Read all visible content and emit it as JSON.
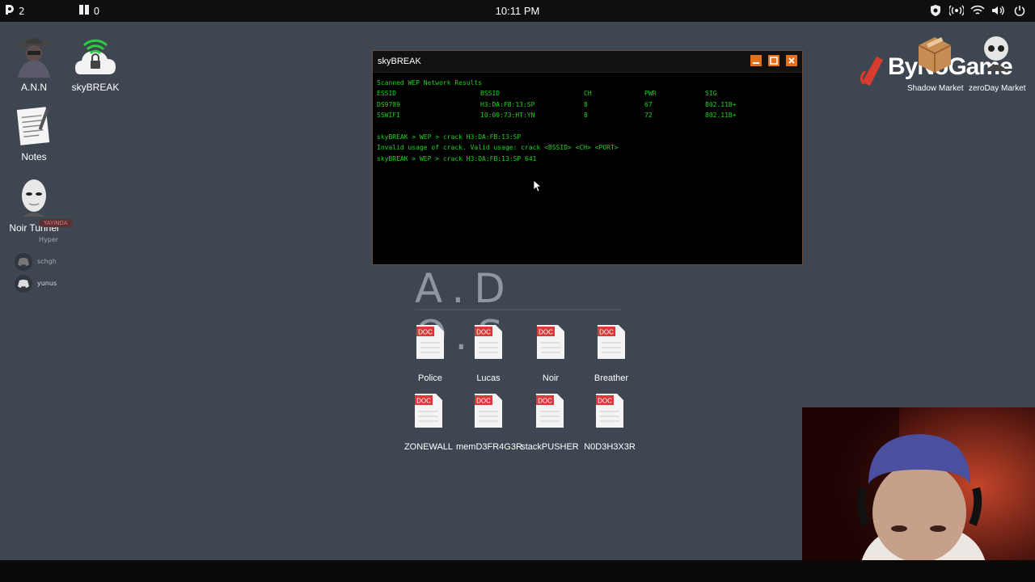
{
  "topbar": {
    "left_count_1": "2",
    "left_count_2": "0",
    "clock": "10:11 PM"
  },
  "desktop_icons": [
    {
      "label": "A.N.N",
      "icon": "hacker-avatar-icon"
    },
    {
      "label": "skyBREAK",
      "icon": "wifi-lock-icon"
    },
    {
      "label": "Notes",
      "icon": "notes-icon"
    },
    {
      "label": "Noir Tunnel",
      "icon": "mask-icon"
    }
  ],
  "streamer_overlay": {
    "badge": "YAYINDA",
    "users": [
      "Hyper",
      "schgh",
      "yunus"
    ]
  },
  "window": {
    "title": "skyBREAK",
    "heading": "Scanned WEP Network Results",
    "columns": [
      "ESSID",
      "BSSID",
      "CH",
      "PWR",
      "SIG"
    ],
    "networks": [
      {
        "essid": "DS9789",
        "bssid": "H3:DA:FB:13:SP",
        "ch": "8",
        "pwr": "67",
        "sig": "802.11B+"
      },
      {
        "essid": "SSWIFI",
        "bssid": "I0:09:73:HT:YN",
        "ch": "8",
        "pwr": "72",
        "sig": "802.11B+"
      }
    ],
    "lines": [
      "skyBREAK > WEP > crack H3:DA:FB:13:SP",
      "Invalid usage of crack. Valid usage: crack <BSSID> <CH> <PORT>",
      "skyBREAK > WEP > crack H3:DA:FB:13:SP 641"
    ],
    "accent": "#e2711d",
    "terminal_color": "#20d020"
  },
  "os_logo": "A.D O.S",
  "documents": [
    {
      "label": "Police",
      "badge": "DOC"
    },
    {
      "label": "Lucas",
      "badge": "DOC"
    },
    {
      "label": "Noir",
      "badge": "DOC"
    },
    {
      "label": "Breather",
      "badge": "DOC"
    },
    {
      "label": "ZONEWALL",
      "badge": "DOC"
    },
    {
      "label": "memD3FR4G3R",
      "badge": "DOC"
    },
    {
      "label": "stackPUSHER",
      "badge": "DOC"
    },
    {
      "label": "N0D3H3X3R",
      "badge": "DOC"
    }
  ],
  "brand": {
    "text": "ByNoGame"
  },
  "markets": [
    "Shadow Market",
    "zeroDay Market"
  ]
}
